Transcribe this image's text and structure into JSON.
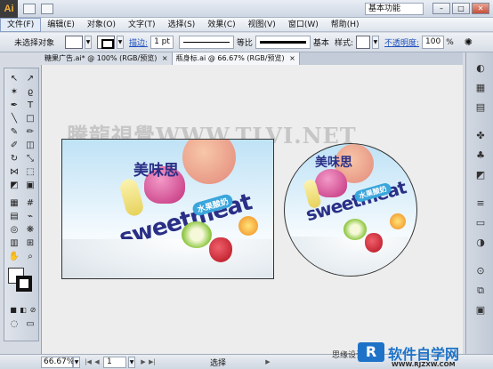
{
  "app": {
    "logo": "Ai",
    "workspace": "基本功能",
    "window_buttons": [
      "–",
      "□",
      "✕"
    ]
  },
  "menu": [
    "文件(F)",
    "编辑(E)",
    "对象(O)",
    "文字(T)",
    "选择(S)",
    "效果(C)",
    "视图(V)",
    "窗口(W)",
    "帮助(H)"
  ],
  "controlbar": {
    "selection_label": "未选择对象",
    "stroke_link": "描边:",
    "stroke_weight": "1 pt",
    "profile_label": "等比",
    "brush_label": "基本",
    "style_label": "样式:",
    "opacity_link": "不透明度:",
    "opacity_value": "100",
    "opacity_unit": "%"
  },
  "tabs": [
    {
      "label": "糖果广告.ai* @ 100% (RGB/预览)",
      "active": false
    },
    {
      "label": "瓶身标.ai @ 66.67% (RGB/预览)",
      "active": true
    }
  ],
  "canvas": {
    "watermark": "騰龍視覺WWW.TLVI.NET",
    "brand_cn": "美味思",
    "brand_en": "sweetmeat",
    "sub_badge": "水果酸奶"
  },
  "status": {
    "zoom": "66.67%",
    "page": "1",
    "tool": "选择"
  },
  "site": {
    "left_text": "思缘设计门",
    "logo_text": "软件自学网",
    "logo_url": "WWW.RJZXW.COM"
  },
  "colors": {
    "accent": "#1c4fbf",
    "brand_text": "#2a2f86",
    "badge": "#3aa6dc"
  }
}
